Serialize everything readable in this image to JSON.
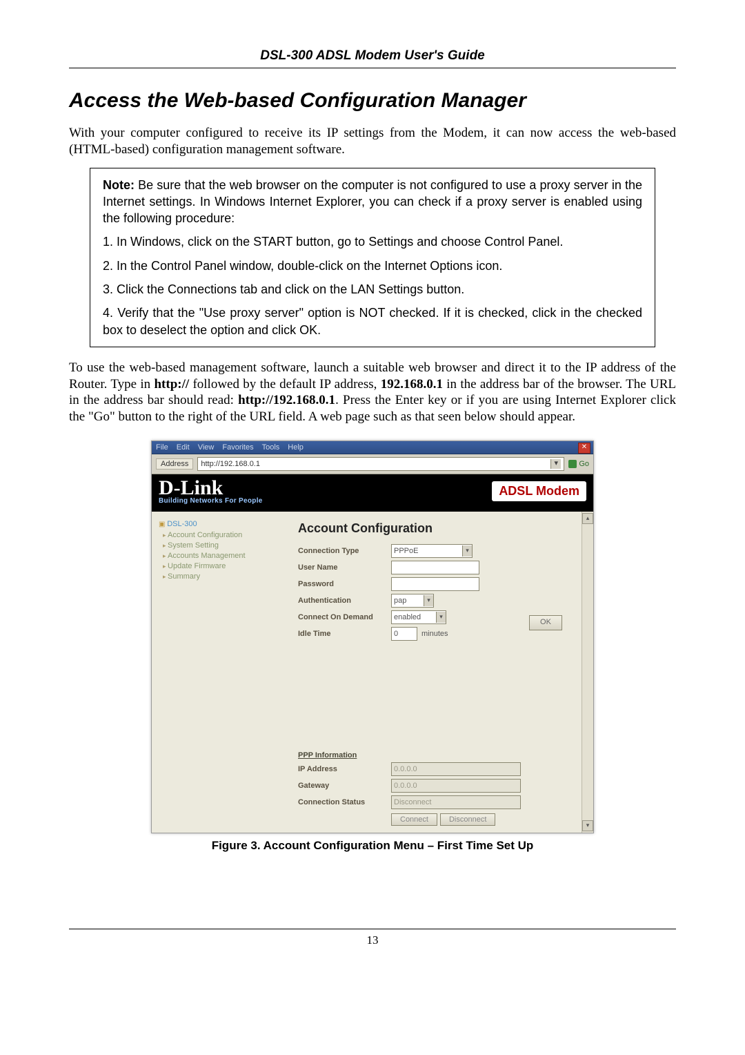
{
  "header": {
    "doc_title": "DSL-300 ADSL Modem User's Guide"
  },
  "title": "Access the Web-based Configuration  Manager",
  "intro": "With your computer configured to receive its IP settings from the Modem, it can now access the web-based (HTML-based) configuration management software.",
  "note": {
    "lead_bold": "Note:",
    "lead": " Be sure that the web browser on the computer is not configured to use a proxy server in the Internet settings. In Windows Internet Explorer, you can check if a proxy server is enabled using the following procedure:",
    "step1": "1. In Windows, click on the START button, go to Settings and choose Control Panel.",
    "step2": "2. In the Control Panel window, double-click on the Internet Options icon.",
    "step3": "3. Click the Connections tab and click on the LAN Settings button.",
    "step4": "4. Verify that the \"Use proxy server\" option is NOT checked. If it is checked, click in the checked box to deselect the option and click OK."
  },
  "post_pre": "To use the web-based management software, launch a suitable web browser and direct it to the IP address of the Router. Type in ",
  "post_http": "http://",
  "post_mid1": " followed by the default IP address, ",
  "post_ip": "192.168.0.1",
  "post_mid2": " in the address bar of the browser. The URL in the address bar should read: ",
  "post_url": "http://192.168.0.1",
  "post_end": ". Press the Enter key or if you are using Internet Explorer click the \"Go\" button to the right of the URL field. A web page such as that seen below should appear.",
  "browser": {
    "menu": {
      "file": "File",
      "edit": "Edit",
      "view": "View",
      "favorites": "Favorites",
      "tools": "Tools",
      "help": "Help"
    },
    "address_label": "Address",
    "url": "http://192.168.0.1",
    "go": "Go"
  },
  "dlink": {
    "logo": "D-Link",
    "tagline": "Building Networks For People",
    "badge": "ADSL Modem"
  },
  "nav": {
    "root": "DSL-300",
    "items": [
      "Account Configuration",
      "System Setting",
      "Accounts Management",
      "Update Firmware",
      "Summary"
    ]
  },
  "account": {
    "heading": "Account Configuration",
    "labels": {
      "conn_type": "Connection Type",
      "user": "User Name",
      "pass": "Password",
      "auth": "Authentication",
      "cod": "Connect On Demand",
      "idle": "Idle Time",
      "minutes": "minutes",
      "ok": "OK"
    },
    "values": {
      "conn_type": "PPPoE",
      "user": "",
      "pass": "",
      "auth": "pap",
      "cod": "enabled",
      "idle": "0"
    },
    "ppp": {
      "heading": "PPP Information",
      "ip_lbl": "IP Address",
      "gw_lbl": "Gateway",
      "cs_lbl": "Connection Status",
      "ip": "0.0.0.0",
      "gw": "0.0.0.0",
      "cs": "Disconnect",
      "connect": "Connect",
      "disconnect": "Disconnect"
    }
  },
  "figure_caption": "Figure 3. Account Configuration Menu – First Time Set Up",
  "page_number": "13"
}
